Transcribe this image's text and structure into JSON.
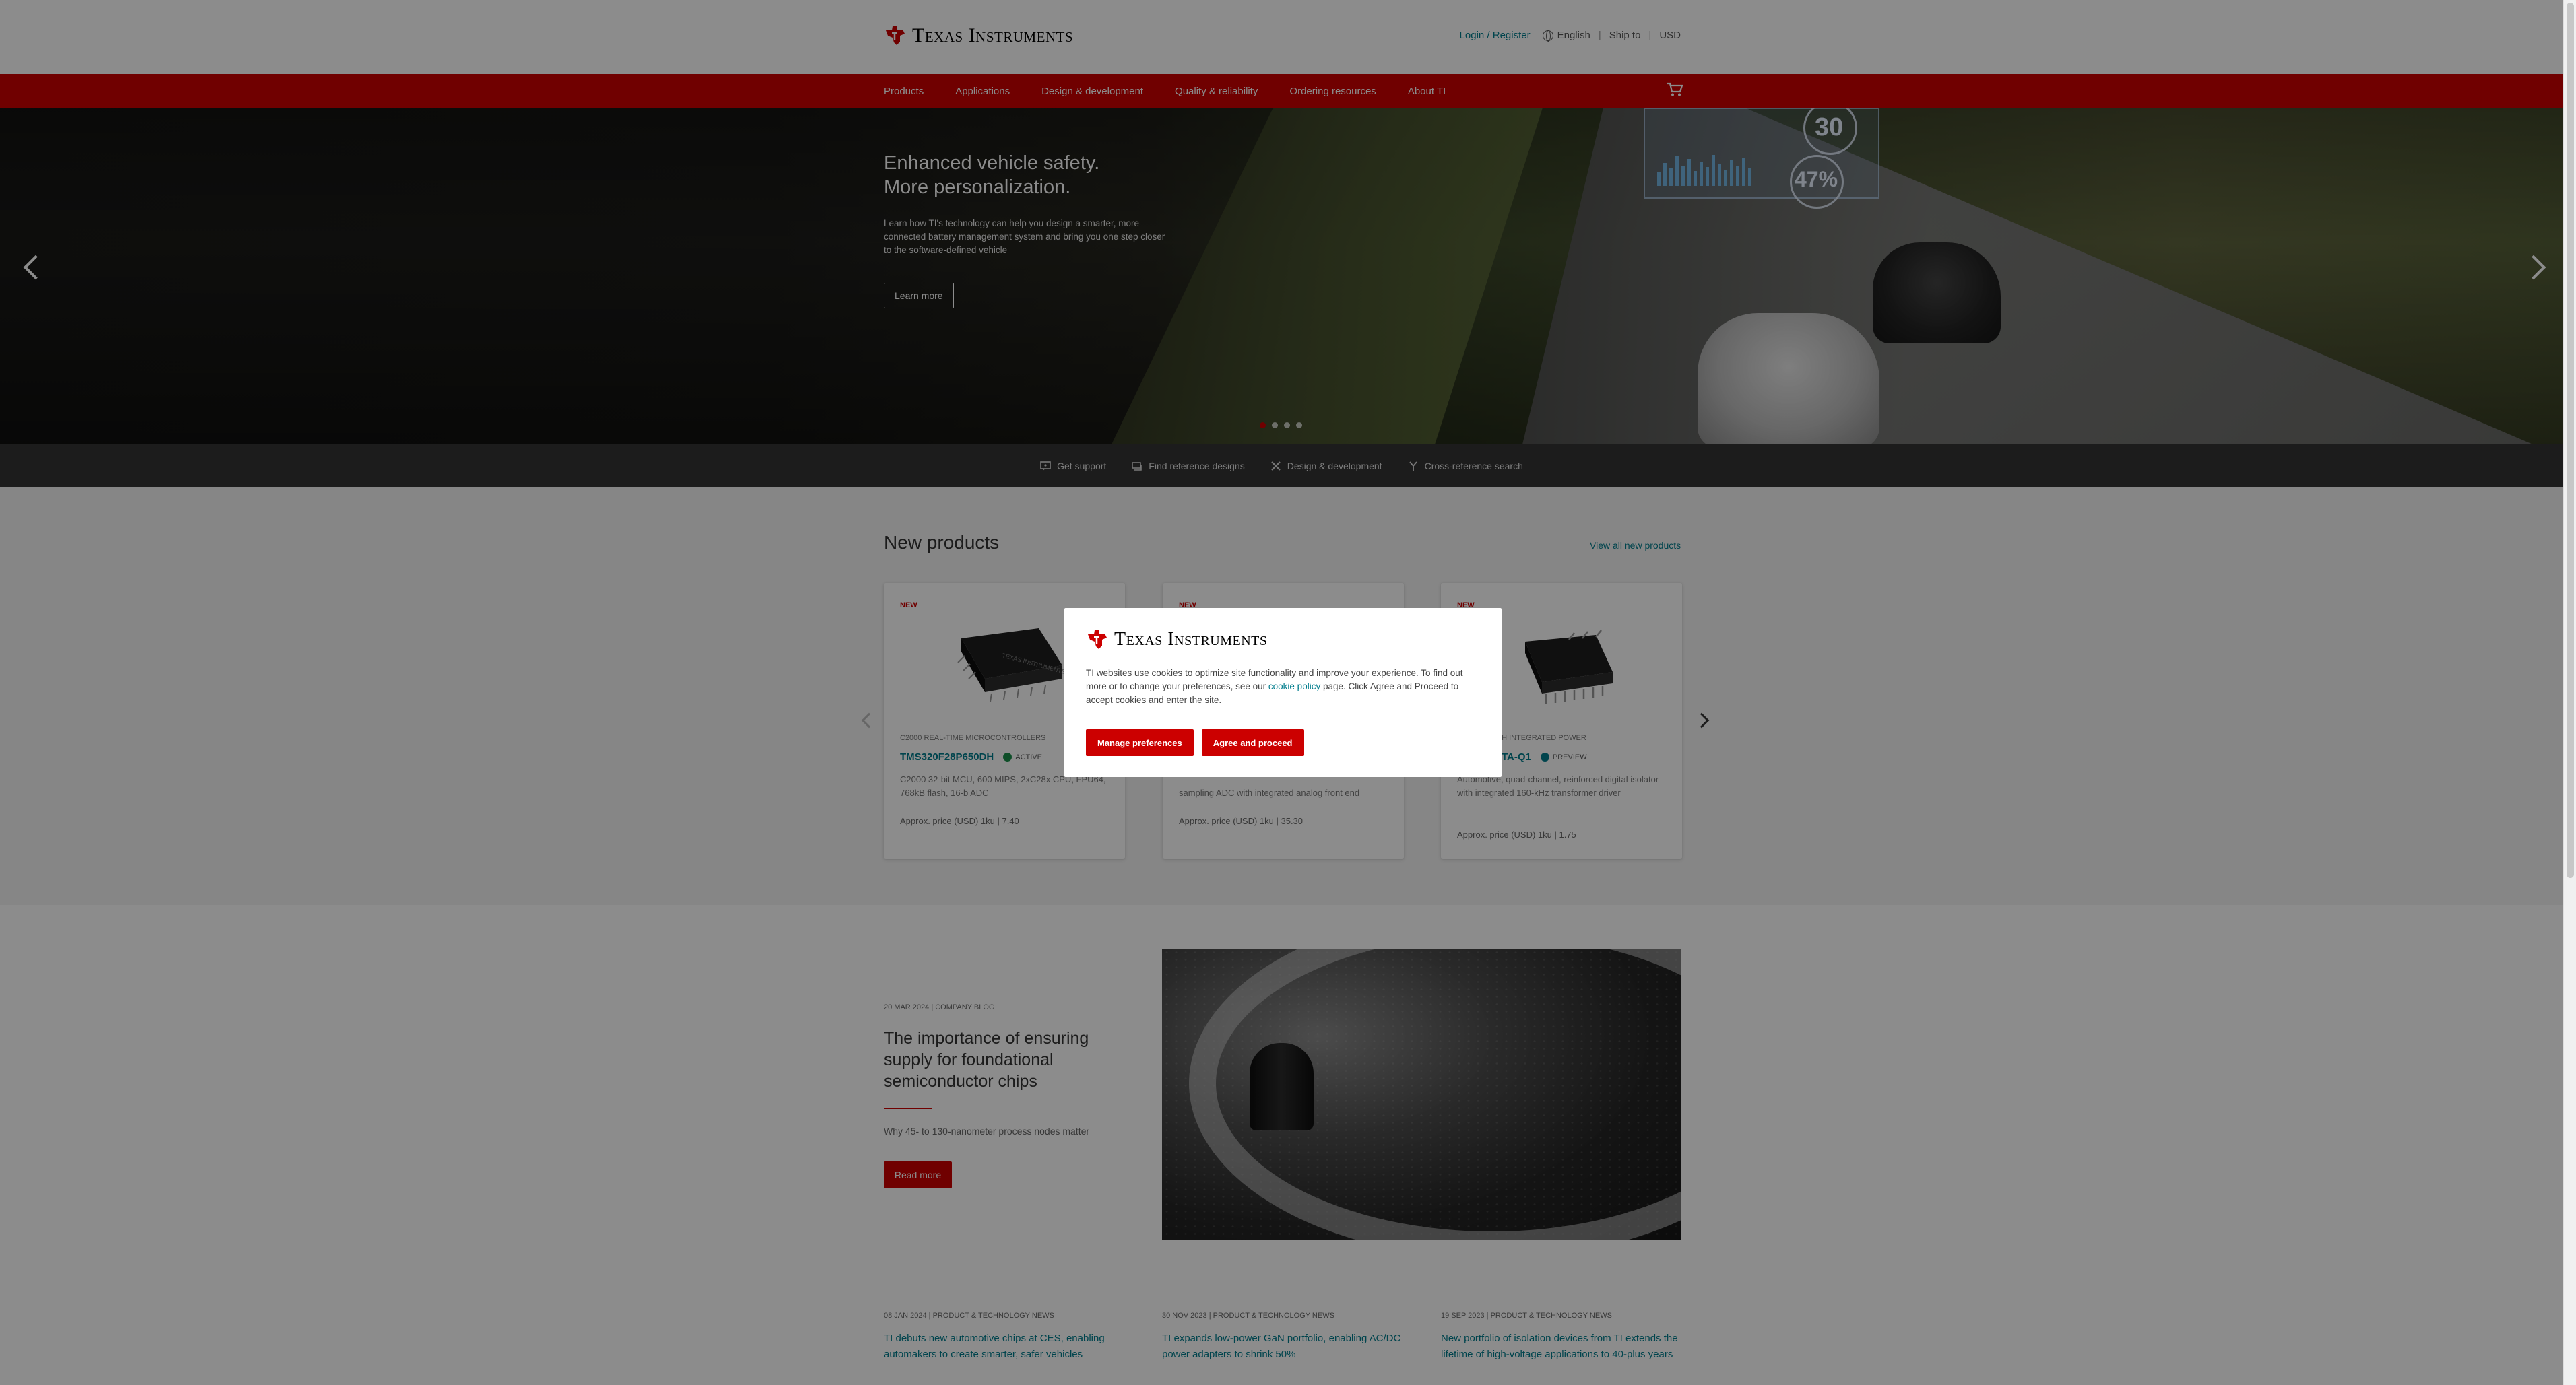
{
  "header": {
    "brand": "Texas Instruments",
    "login": "Login / Register",
    "language": "English",
    "ship_to": "Ship to",
    "currency": "USD"
  },
  "nav": {
    "items": [
      "Products",
      "Applications",
      "Design & development",
      "Quality & reliability",
      "Ordering resources",
      "About TI"
    ]
  },
  "hero": {
    "title_line1": "Enhanced vehicle safety.",
    "title_line2": "More personalization.",
    "body": "Learn how TI's technology can help you design a smarter, more connected battery management system and bring you one step closer to the software-defined vehicle",
    "button": "Learn more",
    "hud_temp": "30",
    "hud_pct": "47%",
    "slides": 4,
    "active_slide": 1
  },
  "quick_links": [
    "Get support",
    "Find reference designs",
    "Design & development",
    "Cross-reference search"
  ],
  "new_products": {
    "title": "New products",
    "view_all": "View all new products",
    "cards": [
      {
        "badge": "NEW",
        "category": "C2000 real-time microcontrollers",
        "part": "TMS320F28P650DH",
        "status": "ACTIVE",
        "description": "C2000 32-bit MCU, 600 MIPS, 2xC28x CPU, FPU64, 768kB flash, 16-b ADC",
        "price": "Approx. price (USD) 1ku | 7.40"
      },
      {
        "badge": "NEW",
        "category": "",
        "part": "",
        "status": "",
        "description": "sampling ADC with integrated analog front end",
        "price": "Approx. price (USD) 1ku | 35.30"
      },
      {
        "badge": "NEW",
        "category": "ators with integrated power",
        "part": "TA-Q1",
        "status": "PREVIEW",
        "description": "Automotive, quad-channel, reinforced digital isolator with integrated 160-kHz transformer driver",
        "price": "Approx. price (USD) 1ku | 1.75"
      }
    ]
  },
  "feature": {
    "meta": "20 MAR 2024 | COMPANY BLOG",
    "title": "The importance of ensuring supply for foundational semiconductor chips",
    "subtitle": "Why 45- to 130-nanometer process nodes matter",
    "button": "Read more"
  },
  "news": [
    {
      "meta": "08 JAN 2024 | PRODUCT & TECHNOLOGY NEWS",
      "title": "TI debuts new automotive chips at CES, enabling automakers to create smarter, safer vehicles"
    },
    {
      "meta": "30 NOV 2023 | PRODUCT & TECHNOLOGY NEWS",
      "title": "TI expands low-power GaN portfolio, enabling AC/DC power adapters to shrink 50%"
    },
    {
      "meta": "19 SEP 2023 | PRODUCT & TECHNOLOGY NEWS",
      "title": "New portfolio of isolation devices from TI extends the lifetime of high-voltage applications to 40-plus years"
    }
  ],
  "cookie_modal": {
    "brand": "Texas Instruments",
    "text_before": "TI websites use cookies to optimize site functionality and improve your experience. To find out more or to change your preferences, see our ",
    "link": "cookie policy",
    "text_after": " page. Click Agree and Proceed to accept cookies and enter the site.",
    "manage": "Manage preferences",
    "agree": "Agree and proceed"
  },
  "colors": {
    "brand_red": "#cc0000",
    "link_teal": "#007c8c",
    "dark_bar": "#333333"
  }
}
